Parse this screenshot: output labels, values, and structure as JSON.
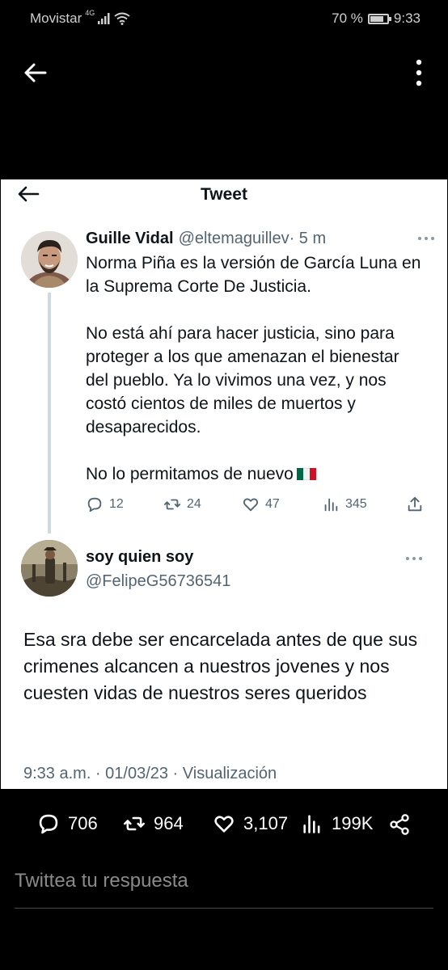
{
  "status_bar": {
    "carrier": "Movistar",
    "network": "4G",
    "battery": "70 %",
    "time": "9:33"
  },
  "card": {
    "title": "Tweet",
    "main_tweet": {
      "name": "Guille Vidal",
      "handle": "@eltemaguillev",
      "time": "· 5 m",
      "paragraphs": [
        "Norma Piña es la versión de García Luna en la Suprema Corte De Justicia.",
        "No está ahí para hacer justicia, sino para proteger a los que amenazan el bienestar del pueblo. Ya lo vivimos una vez, y nos costó cientos de miles de muertos y desaparecidos.",
        "No lo permitamos de nuevo"
      ],
      "stats": {
        "replies": "12",
        "retweets": "24",
        "likes": "47",
        "views": "345"
      }
    },
    "reply_tweet": {
      "name": "soy quien soy",
      "handle": "@FelipeG56736541",
      "text": "Esa sra debe ser encarcelada antes de que sus crimenes alcancen a nuestros jovenes y nos cuesten vidas de nuestros seres queridos",
      "meta": "9:33 a.m. · 01/03/23 · Visualización"
    }
  },
  "bottom_stats": {
    "replies": "706",
    "retweets": "964",
    "likes": "3,107",
    "views": "199K"
  },
  "reply_input": {
    "placeholder": "Twittea tu respuesta"
  },
  "colors": {
    "background": "#000000",
    "card": "#ffffff",
    "text": "#0f1419",
    "secondary": "#536471",
    "thread_line": "#cfd9de"
  },
  "icons": [
    "back-arrow-icon",
    "more-vertical-icon",
    "reply-icon",
    "retweet-icon",
    "like-icon",
    "views-icon",
    "share-icon",
    "mexico-flag-icon"
  ]
}
